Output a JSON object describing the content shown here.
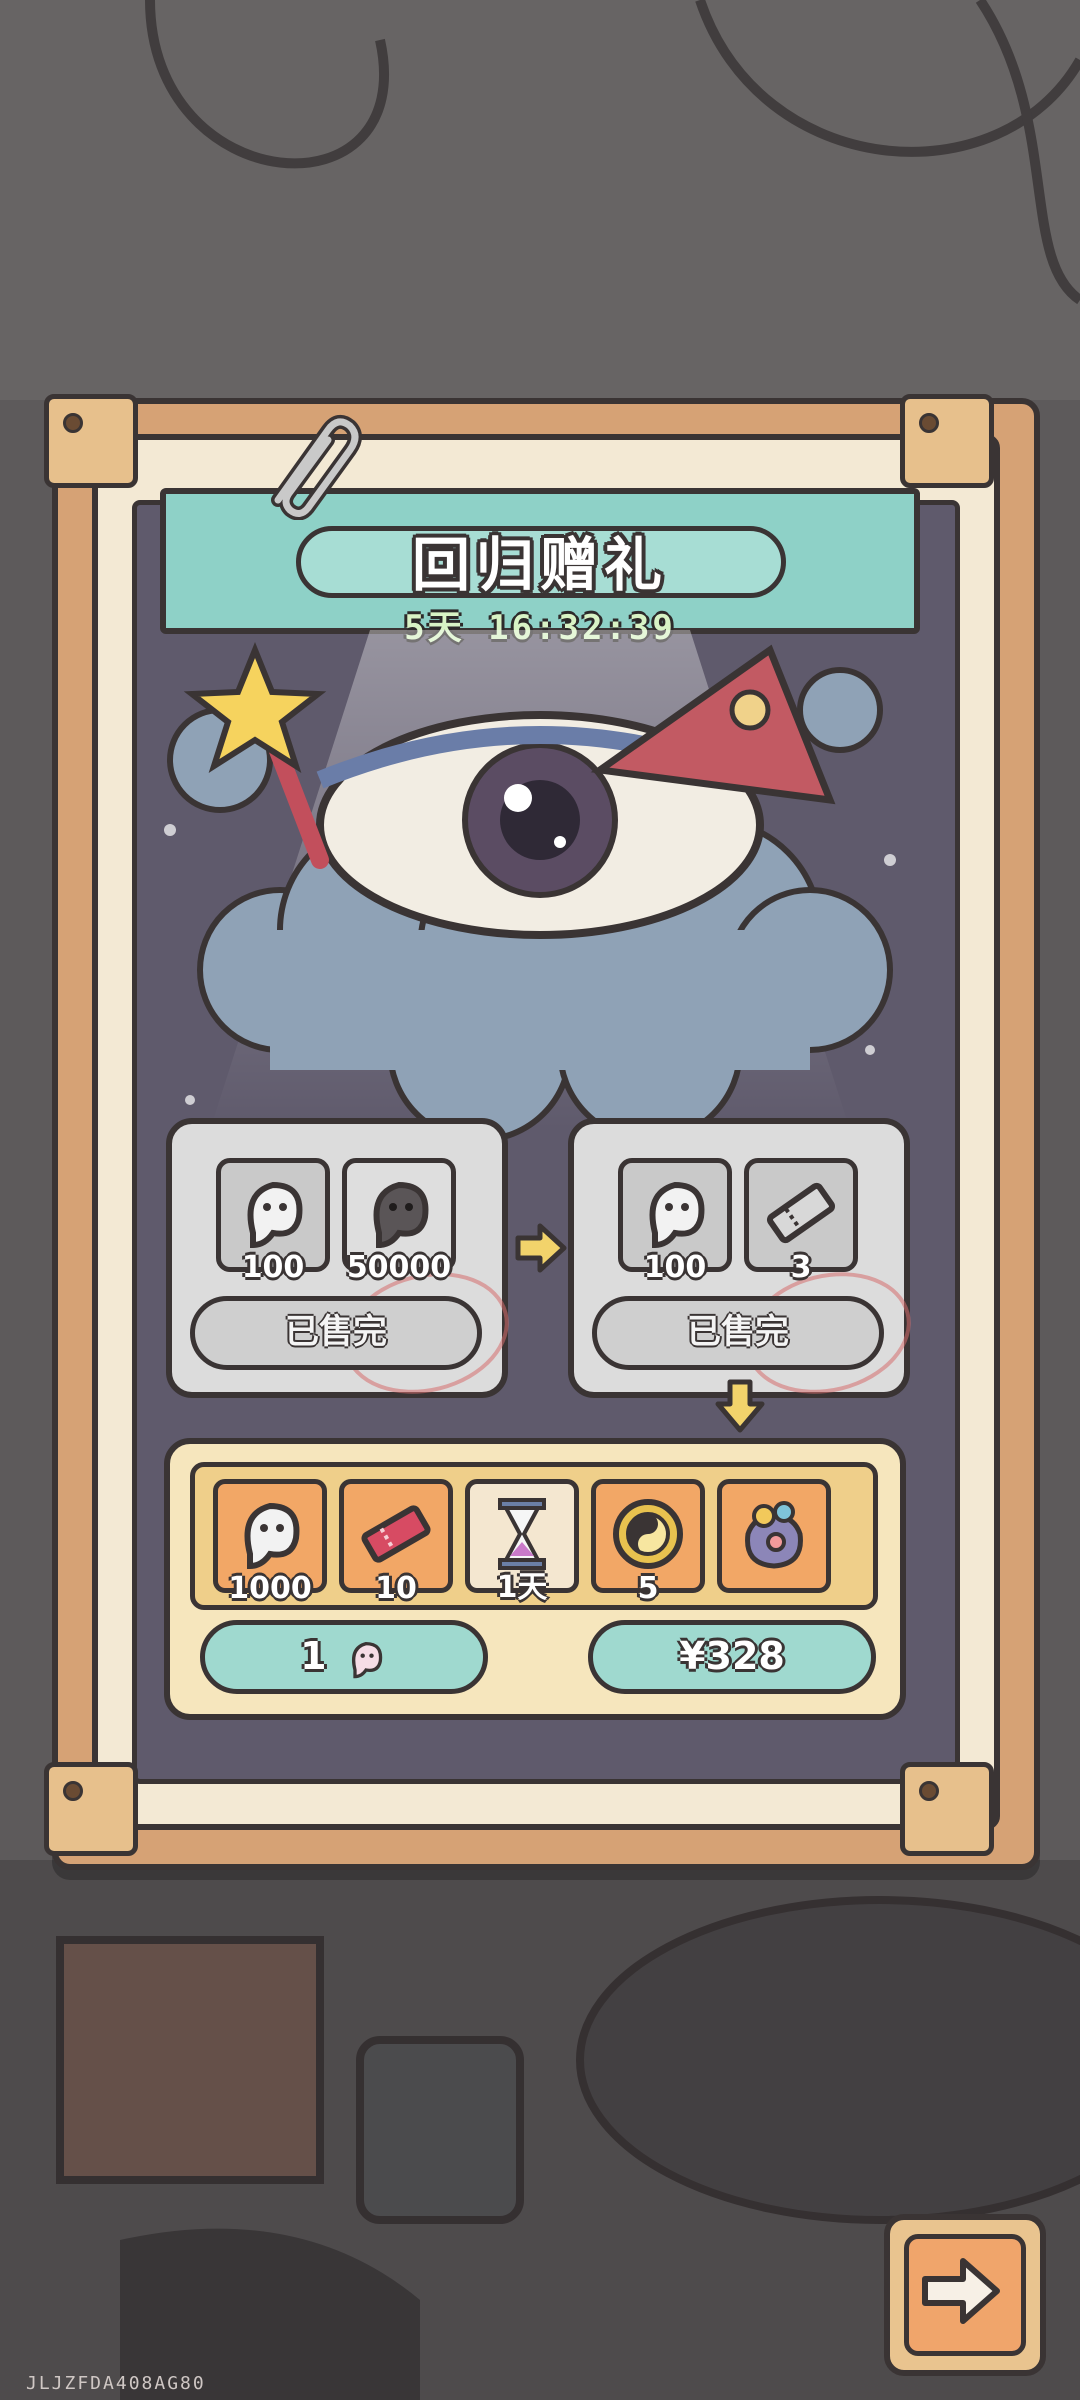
{
  "popup": {
    "title": "回归赠礼",
    "countdown": "5天 16:32:39"
  },
  "offers": [
    {
      "items": [
        {
          "icon": "ghost-currency-icon",
          "label": "100"
        },
        {
          "icon": "dark-ghost-icon",
          "label": "50000"
        }
      ],
      "button": "已售完"
    },
    {
      "items": [
        {
          "icon": "ghost-currency-icon",
          "label": "100"
        },
        {
          "icon": "ticket-icon",
          "label": "3"
        }
      ],
      "button": "已售完"
    }
  ],
  "bundle": {
    "items": [
      {
        "icon": "ghost-currency-icon",
        "label": "1000"
      },
      {
        "icon": "red-ticket-icon",
        "label": "10"
      },
      {
        "icon": "hourglass-icon",
        "label": "1天"
      },
      {
        "icon": "yin-yang-coin-icon",
        "label": "5"
      },
      {
        "icon": "treasure-bag-icon",
        "label": ""
      }
    ],
    "ghost_button_label": "1",
    "price_button_label": "¥328"
  },
  "footer": {
    "build_id": "JLJZFDA408AG80"
  },
  "colors": {
    "teal": "#8ed1c7",
    "frame": "#d6a275",
    "bundle_orange": "#f2a766",
    "sold_gray": "#dcdcdc"
  }
}
